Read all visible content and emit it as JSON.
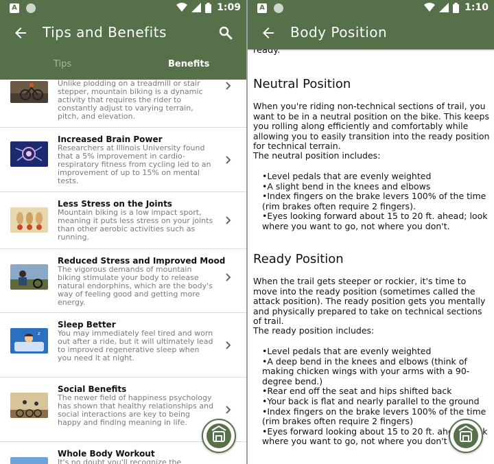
{
  "status_left": {
    "time": "1:09",
    "notif_letter": "A"
  },
  "status_right": {
    "time": "1:10",
    "notif_letter": "A"
  },
  "colors": {
    "accent": "#56704a",
    "tab_inactive": "#a9b8a2",
    "desc_text": "#7a7a7a"
  },
  "left": {
    "title": "Tips and Benefits",
    "tabs": [
      {
        "label": "Tips",
        "active": false
      },
      {
        "label": "Benefits",
        "active": true
      }
    ],
    "items": [
      {
        "title": "",
        "description": "Unlike plodding on a treadmill or stair stepper, mountain biking is a dynamic activity that requires the rider to constantly adjust to varying terrain, pitch, and elevation."
      },
      {
        "title": "Increased Brain Power",
        "description": "Researchers at Illinois University found that a 5% improvement in cardio-respiratory fitness from cycling led to an improvement of up to 15% on mental tests."
      },
      {
        "title": "Less Stress on the Joints",
        "description": "Mountain biking is a low impact sport, meaning it puts less stress on your joints than other aerobic activities such as running."
      },
      {
        "title": "Reduced Stress and Improved Mood",
        "description": "The vigorous demands of mountain biking stimulate your body to release natural endorphins, which are the body's way of feeling good and getting more energy."
      },
      {
        "title": "Sleep Better",
        "description": "You may immediately feel tired and worn out after a ride, but it will ultimately lead to improved regenerative sleep when you need it at night."
      },
      {
        "title": "Social Benefits",
        "description": "The newer field of happiness psychology has shown that healthy relationships and social interactions are key to being happy and finding meaning in life."
      },
      {
        "title": "Whole Body Workout",
        "description": "It's no doubt you'll recognize the"
      }
    ]
  },
  "right": {
    "title": "Body Position",
    "cut_text": "ready.",
    "sections": [
      {
        "heading": "Neutral Position",
        "intro": "When you're riding non-technical sections of trail, you want to be in a neutral position on the bike. This keeps you rolling along efficiently and comfortably while allowing you to easily transition into the ready position for technical terrain.",
        "includes": "The neutral position includes:",
        "bullets": [
          "•Level pedals that are evenly weighted",
          "•A slight bend in the knees and elbows",
          "•Index fingers on the brake levers 100% of the time (rim brakes often require 2 fingers).",
          "•Eyes looking forward about 15 to 20 ft. ahead; look where you want to go, not where you don't."
        ]
      },
      {
        "heading": "Ready Position",
        "intro": "When the trail gets steeper or rockier, it's time to move into the ready position (sometimes called the attack position). The ready position gets you mentally and physically prepared to take on technical sections of trail.",
        "includes": "The ready position includes:",
        "bullets": [
          "•Level pedals that are evenly weighted",
          "•A deep bend in the knees and elbows (think of making chicken wings with your arms with a 90-degree bend.)",
          "•Rear end off the seat and hips shifted back",
          "•Your back is flat and nearly parallel to the ground",
          "•Index fingers on the brake levers 100% of the time (rim brakes often require 2 fingers)",
          "•Eyes forward looking about 15 to 20 ft. ahead; look where you want to go, not where you don't"
        ]
      }
    ]
  }
}
